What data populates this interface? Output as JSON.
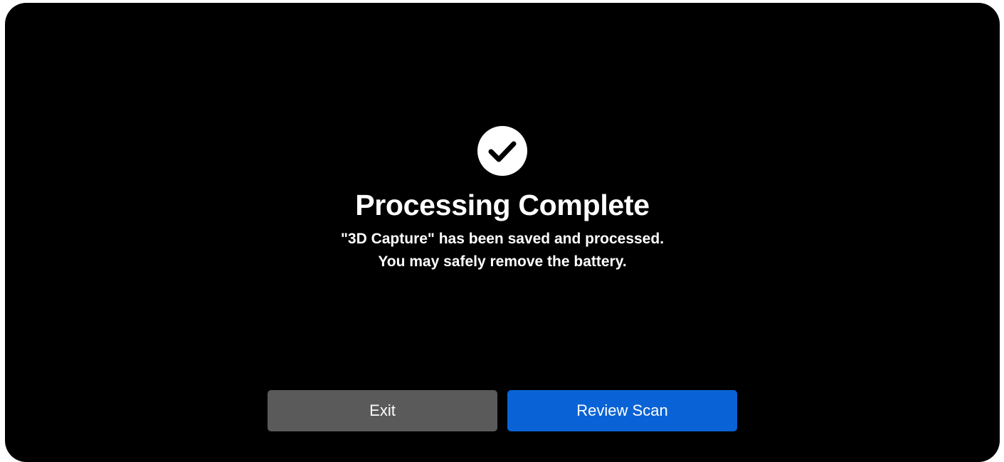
{
  "dialog": {
    "icon": "checkmark-circle-icon",
    "title": "Processing Complete",
    "message_line1": "\"3D Capture\" has been saved and processed.",
    "message_line2": "You may safely remove the battery."
  },
  "actions": {
    "exit_label": "Exit",
    "review_label": "Review Scan"
  },
  "colors": {
    "background": "#000000",
    "exit_button": "#5a5a5a",
    "review_button": "#0a63d6",
    "text": "#ffffff"
  }
}
